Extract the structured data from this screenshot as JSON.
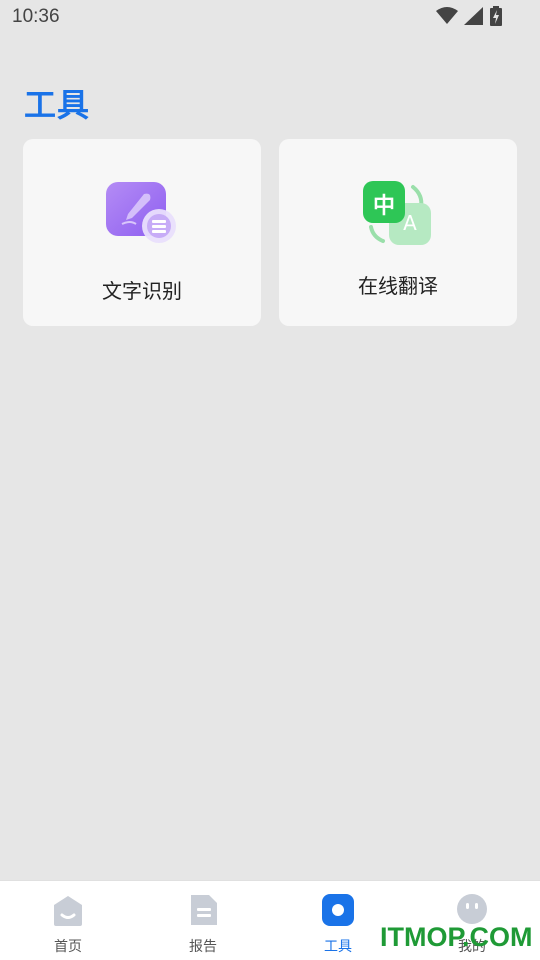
{
  "status_bar": {
    "time": "10:36",
    "icons": [
      "wifi-icon",
      "cell-signal-icon",
      "battery-charging-icon"
    ]
  },
  "page": {
    "title": "工具"
  },
  "tools": [
    {
      "label": "文字识别",
      "icon": "text-recognition-icon",
      "color": "#a77cf2"
    },
    {
      "label": "在线翻译",
      "icon": "translate-icon",
      "badge_primary": "中",
      "badge_secondary": "A",
      "color": "#2ec656"
    }
  ],
  "tabbar": {
    "active_color": "#1a73e8",
    "inactive_color": "#c8cdd6",
    "items": [
      {
        "label": "首页",
        "icon": "home-icon"
      },
      {
        "label": "报告",
        "icon": "report-icon"
      },
      {
        "label": "工具",
        "icon": "tools-icon",
        "active": true
      },
      {
        "label": "我的",
        "icon": "profile-icon"
      }
    ]
  },
  "watermark": "ITMOP.COM"
}
